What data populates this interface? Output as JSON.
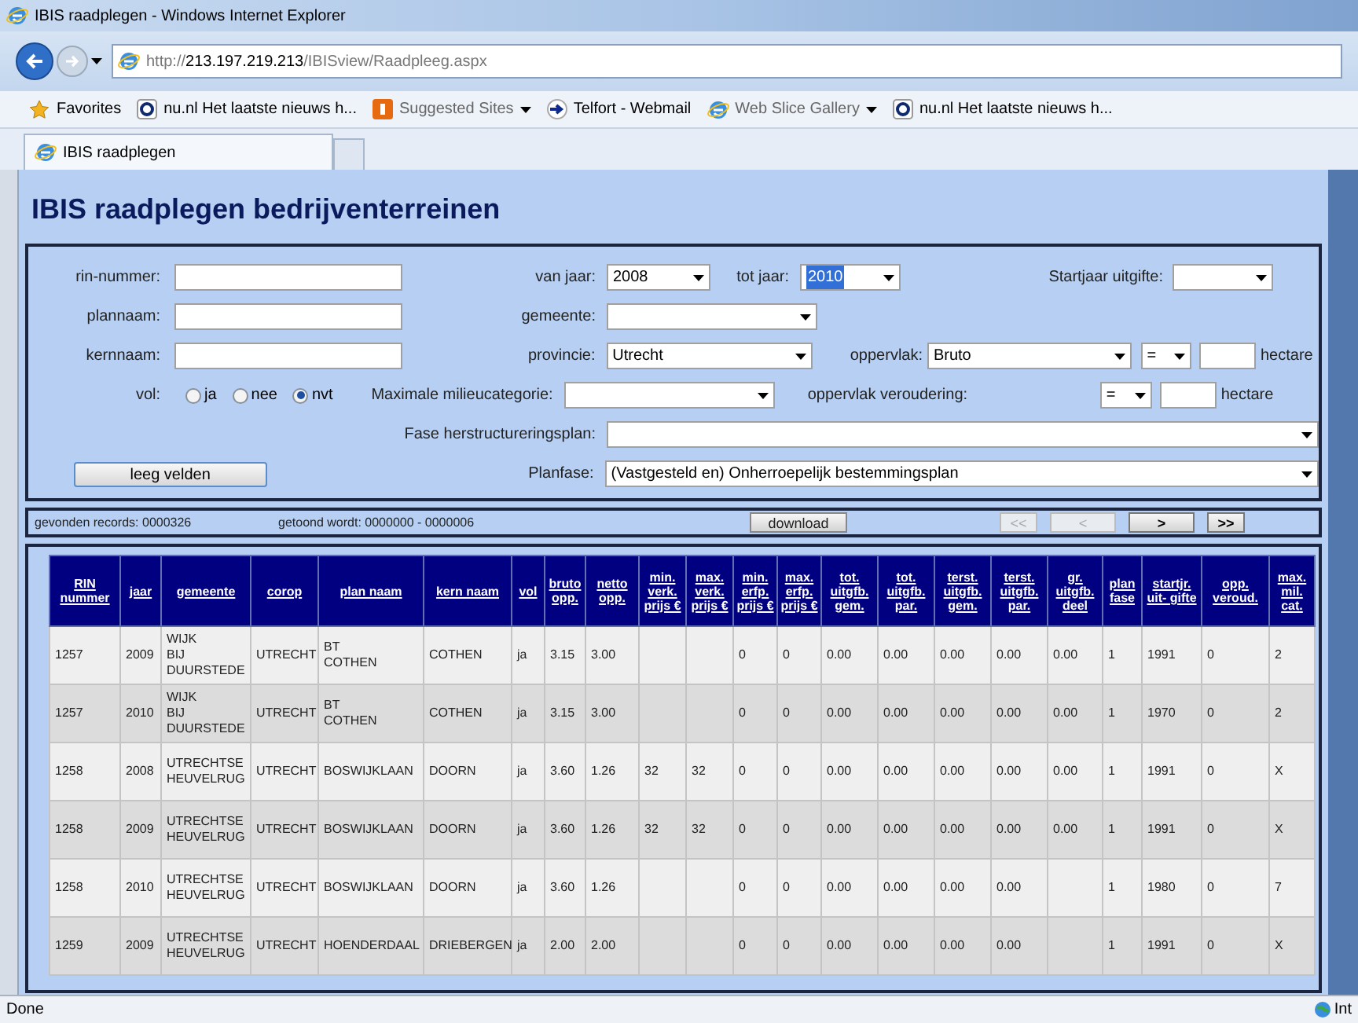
{
  "browser": {
    "title": "IBIS raadplegen - Windows Internet Explorer",
    "address_prefix": "http://",
    "address_host": "213.197.219.213",
    "address_path": "/IBISview/Raadpleeg.aspx",
    "favorites": [
      {
        "kind": "favorites",
        "label": "Favorites",
        "dropdown": false
      },
      {
        "kind": "site",
        "label": "nu.nl  Het laatste nieuws h...",
        "dropdown": false
      },
      {
        "kind": "suggested",
        "label": "Suggested Sites",
        "dropdown": true
      },
      {
        "kind": "telfort",
        "label": "Telfort - Webmail",
        "dropdown": false
      },
      {
        "kind": "ie",
        "label": "Web Slice Gallery",
        "dropdown": true
      },
      {
        "kind": "site",
        "label": "nu.nl  Het laatste nieuws h...",
        "dropdown": false
      }
    ],
    "tab": "IBIS raadplegen"
  },
  "page_title": "IBIS raadplegen bedrijventerreinen",
  "form": {
    "rin_nummer": {
      "label": "rin-nummer:"
    },
    "plannaam": {
      "label": "plannaam:"
    },
    "kernnaam": {
      "label": "kernnaam:"
    },
    "van_jaar": {
      "label": "van jaar:",
      "value": "2008",
      "highlighted": false
    },
    "tot_jaar": {
      "label": "tot jaar:",
      "value": "2010",
      "highlighted": true
    },
    "startjaar": {
      "label": "Startjaar uitgifte:"
    },
    "gemeente": {
      "label": "gemeente:"
    },
    "provincie": {
      "label": "provincie:",
      "value": "Utrecht"
    },
    "oppervlak": {
      "label": "oppervlak:",
      "value": "Bruto",
      "operator": "=",
      "unit": "hectare"
    },
    "vol": {
      "label": "vol:",
      "options": [
        {
          "label": "ja",
          "selected": false
        },
        {
          "label": "nee",
          "selected": false
        },
        {
          "label": "nvt",
          "selected": true
        }
      ]
    },
    "milieucategorie": {
      "label": "Maximale milieucategorie:"
    },
    "oppervlak_veroudering": {
      "label": "oppervlak veroudering:",
      "operator": "=",
      "unit": "hectare"
    },
    "fase": {
      "label": "Fase herstructureringsplan:"
    },
    "planfase": {
      "label": "Planfase:",
      "value": "(Vastgesteld en) Onherroepelijk bestemmingsplan"
    },
    "clear_button": "leeg velden"
  },
  "records": {
    "found": "gevonden records: 0000326",
    "shown": "getoond wordt: 0000000 - 0000006",
    "download": "download",
    "pager": [
      {
        "label": "<<",
        "disabled": true
      },
      {
        "label": "<",
        "disabled": true
      },
      {
        "label": ">",
        "disabled": false
      },
      {
        "label": ">>",
        "disabled": false
      }
    ]
  },
  "table": {
    "columns": [
      "RIN nummer",
      "jaar",
      "gemeente",
      "corop",
      "plan naam",
      "kern naam",
      "vol",
      "bruto opp.",
      "netto opp.",
      "min. verk. prijs €",
      "max. verk. prijs €",
      "min. erfp. prijs €",
      "max. erfp. prijs €",
      "tot. uitgfb. gem.",
      "tot. uitgfb. par.",
      "terst. uitgfb. gem.",
      "terst. uitgfb. par.",
      "gr. uitgfb. deel",
      "plan fase",
      "startjr. uit- gifte",
      "opp. veroud.",
      "max. mil. cat."
    ],
    "rows": [
      [
        "1257",
        "2009",
        "WIJK\nBIJ\nDUURSTEDE",
        "UTRECHT",
        "BT\nCOTHEN",
        "COTHEN",
        "ja",
        "3.15",
        "3.00",
        "",
        "",
        "0",
        "0",
        "0.00",
        "0.00",
        "0.00",
        "0.00",
        "0.00",
        "1",
        "1991",
        "0",
        "2"
      ],
      [
        "1257",
        "2010",
        "WIJK\nBIJ\nDUURSTEDE",
        "UTRECHT",
        "BT\nCOTHEN",
        "COTHEN",
        "ja",
        "3.15",
        "3.00",
        "",
        "",
        "0",
        "0",
        "0.00",
        "0.00",
        "0.00",
        "0.00",
        "0.00",
        "1",
        "1970",
        "0",
        "2"
      ],
      [
        "1258",
        "2008",
        "UTRECHTSE\nHEUVELRUG",
        "UTRECHT",
        "BOSWIJKLAAN",
        "DOORN",
        "ja",
        "3.60",
        "1.26",
        "32",
        "32",
        "0",
        "0",
        "0.00",
        "0.00",
        "0.00",
        "0.00",
        "0.00",
        "1",
        "1991",
        "0",
        "X"
      ],
      [
        "1258",
        "2009",
        "UTRECHTSE\nHEUVELRUG",
        "UTRECHT",
        "BOSWIJKLAAN",
        "DOORN",
        "ja",
        "3.60",
        "1.26",
        "32",
        "32",
        "0",
        "0",
        "0.00",
        "0.00",
        "0.00",
        "0.00",
        "0.00",
        "1",
        "1991",
        "0",
        "X"
      ],
      [
        "1258",
        "2010",
        "UTRECHTSE\nHEUVELRUG",
        "UTRECHT",
        "BOSWIJKLAAN",
        "DOORN",
        "ja",
        "3.60",
        "1.26",
        "",
        "",
        "0",
        "0",
        "0.00",
        "0.00",
        "0.00",
        "0.00",
        "",
        "1",
        "1980",
        "0",
        "7"
      ],
      [
        "1259",
        "2009",
        "UTRECHTSE\nHEUVELRUG",
        "UTRECHT",
        "HOENDERDAAL",
        "DRIEBERGEN",
        "ja",
        "2.00",
        "2.00",
        "",
        "",
        "0",
        "0",
        "0.00",
        "0.00",
        "0.00",
        "0.00",
        "",
        "1",
        "1991",
        "0",
        "X"
      ]
    ]
  },
  "status_bar": {
    "text": "Done",
    "zone": "Int"
  }
}
